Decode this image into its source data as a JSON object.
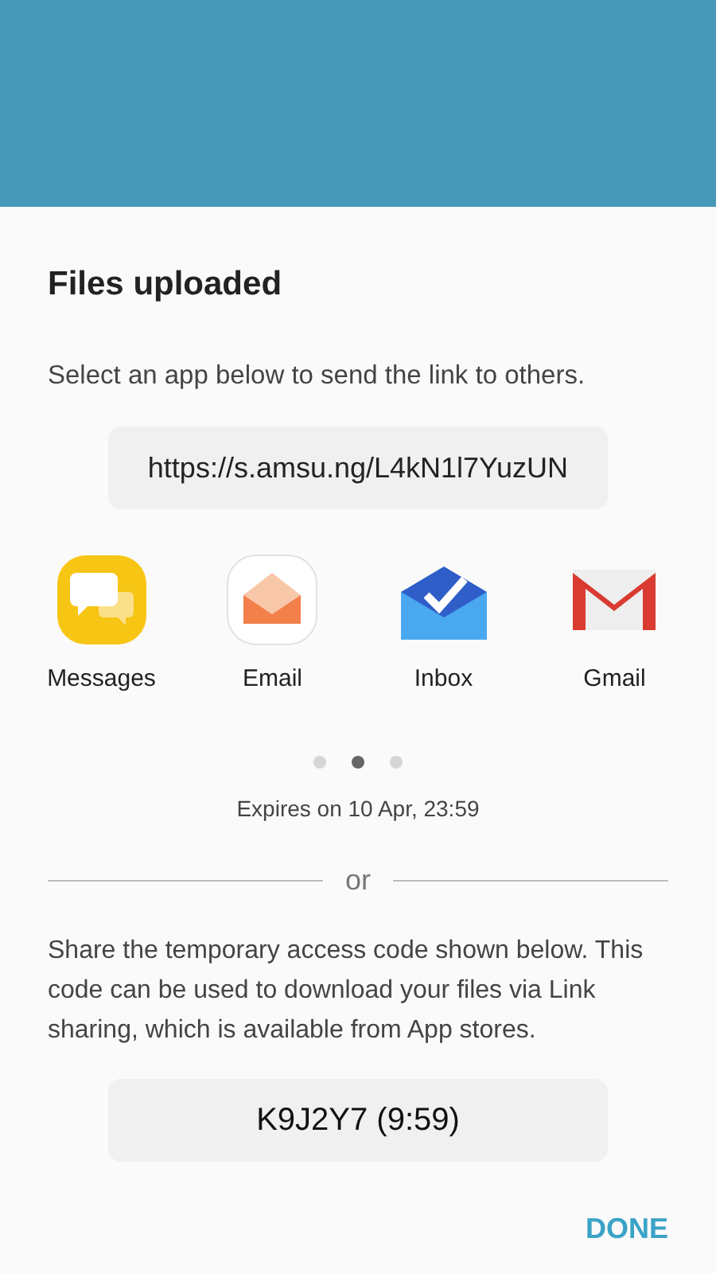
{
  "dialog": {
    "title": "Files uploaded",
    "instruction": "Select an app below to send the link to others.",
    "link": "https://s.amsu.ng/L4kN1l7YuzUN",
    "apps": [
      {
        "kind": "messages",
        "label": "Messages"
      },
      {
        "kind": "email",
        "label": "Email"
      },
      {
        "kind": "inbox",
        "label": "Inbox"
      },
      {
        "kind": "gmail",
        "label": "Gmail"
      }
    ],
    "pages": [
      {
        "selected": false
      },
      {
        "selected": true
      },
      {
        "selected": false
      }
    ],
    "expires": "Expires on 10 Apr, 23:59",
    "divider_text": "or",
    "code_description": "Share the temporary access code shown below. This code can be used to download your files via Link sharing, which is available from App stores.",
    "code": "K9J2Y7 (9:59)",
    "done_button": "DONE"
  }
}
